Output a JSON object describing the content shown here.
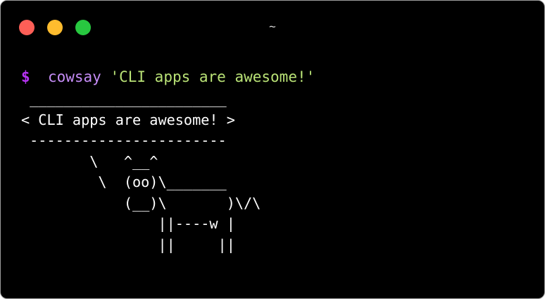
{
  "window": {
    "title": "~",
    "traffic_lights": [
      {
        "name": "close",
        "color": "#fe5f57"
      },
      {
        "name": "minimize",
        "color": "#febc2e"
      },
      {
        "name": "zoom",
        "color": "#28c840"
      }
    ]
  },
  "terminal": {
    "prompt_symbol": "$",
    "command": "cowsay",
    "argument": "'CLI apps are awesome!'",
    "output_lines": [
      " _______________________",
      "< CLI apps are awesome! >",
      " -----------------------",
      "        \\   ^__^",
      "         \\  (oo)\\_______",
      "            (__)\\       )\\/\\",
      "                ||----w |",
      "                ||     ||"
    ],
    "colors": {
      "background": "#000000",
      "prompt": "#b633f2",
      "command": "#c58cf6",
      "argument": "#b9e276",
      "output": "#ffffff"
    }
  }
}
